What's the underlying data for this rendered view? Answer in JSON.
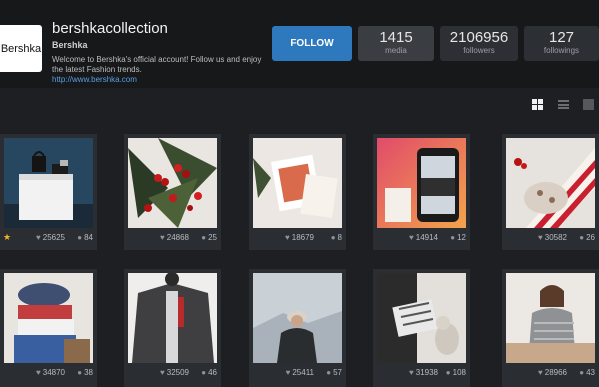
{
  "profile": {
    "logo_text": "Bershka",
    "username": "bershkacollection",
    "full_name": "Bershka",
    "bio": "Welcome to Bershka's official account! Follow us and enjoy the latest Fashion trends.",
    "website": "http://www.bershka.com"
  },
  "actions": {
    "follow_label": "FOLLOW"
  },
  "stats": {
    "media": {
      "value": "1415",
      "label": "media"
    },
    "followers": {
      "value": "2106956",
      "label": "followers"
    },
    "followings": {
      "value": "127",
      "label": "followings"
    }
  },
  "view_modes": {
    "active": "grid",
    "icons": [
      "grid-view-icon",
      "list-view-icon",
      "single-view-icon"
    ]
  },
  "posts": [
    {
      "likes": "25625",
      "comments": "84",
      "starred": true,
      "image": "bags on white pedestal"
    },
    {
      "likes": "24868",
      "comments": "25",
      "starred": false,
      "image": "holly berries"
    },
    {
      "likes": "18679",
      "comments": "8",
      "starred": false,
      "image": "greeting cards"
    },
    {
      "likes": "14914",
      "comments": "12",
      "starred": false,
      "image": "happy holidays smartphone"
    },
    {
      "likes": "30582",
      "comments": "26",
      "starred": false,
      "image": "candy stripes"
    },
    {
      "likes": "34870",
      "comments": "38",
      "starred": false,
      "image": "hats and knitwear"
    },
    {
      "likes": "32509",
      "comments": "46",
      "starred": false,
      "image": "grey coat"
    },
    {
      "likes": "25411",
      "comments": "57",
      "starred": false,
      "image": "man in snowy landscape"
    },
    {
      "likes": "31938",
      "comments": "108",
      "starred": false,
      "image": "patterned bag and dog"
    },
    {
      "likes": "28966",
      "comments": "43",
      "starred": false,
      "image": "woman in striped sweater"
    }
  ],
  "colors": {
    "accent": "#2e78bd",
    "background": "#1d1f22",
    "star": "#f0b429"
  }
}
